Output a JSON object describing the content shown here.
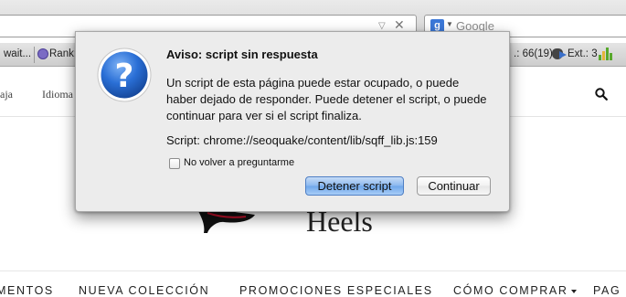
{
  "browser": {
    "search_placeholder": "Google",
    "url_dropdown_glyph": "▽",
    "url_clear_glyph": "✕",
    "search_engine_letter": "g"
  },
  "seo_toolbar": {
    "item_wait": "wait...",
    "item_rank": "Rank:",
    "item_count": ".: 66(19)",
    "item_ext": "Ext.: 3"
  },
  "site": {
    "nav_left_1": "aja",
    "nav_left_2": "Idioma",
    "logo_text": "Heels",
    "menu": [
      "MENTOS",
      "NUEVA COLECCIÓN",
      "PROMOCIONES ESPECIALES",
      "CÓMO COMPRAR",
      "PAG"
    ]
  },
  "dialog": {
    "title": "Aviso: script sin respuesta",
    "message": "Un script de esta página puede estar ocupado, o puede haber dejado de responder. Puede detener el script, o puede continuar para ver si el script finaliza.",
    "script_line": "Script: chrome://seoquake/content/lib/sqff_lib.js:159",
    "checkbox_label": "No volver a preguntarme",
    "checkbox_checked": false,
    "stop_button": "Detener script",
    "continue_button": "Continuar",
    "icon_glyph": "?"
  },
  "colors": {
    "primary_button": "#8ab7ef",
    "dialog_bg": "#ececec",
    "question_icon": "#2a6fd6"
  }
}
